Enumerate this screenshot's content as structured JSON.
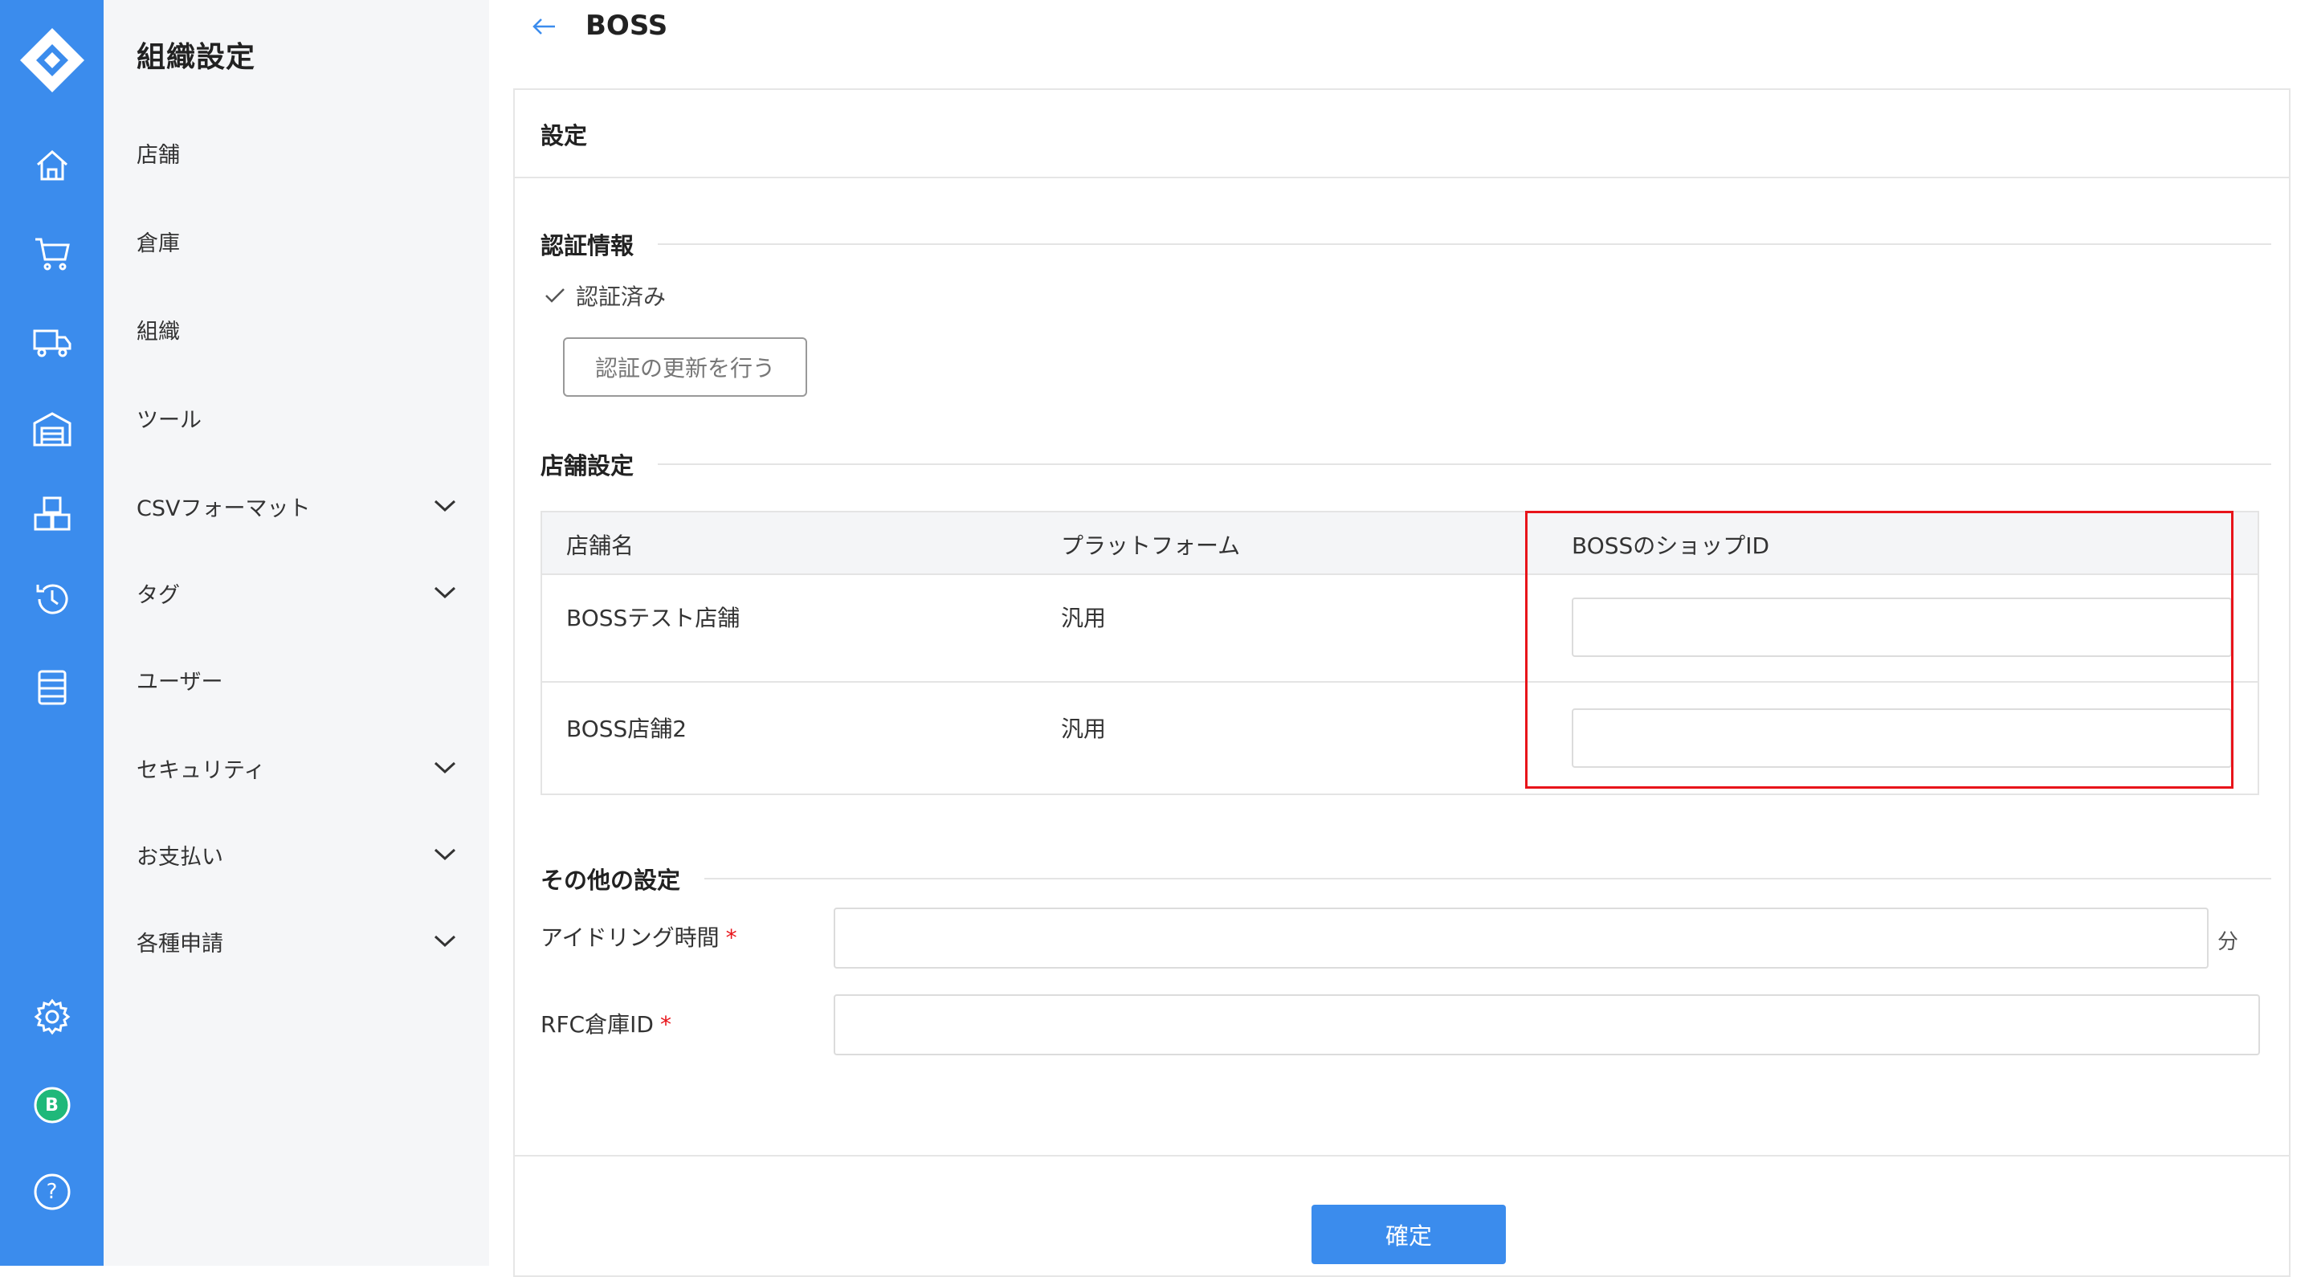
{
  "sidebar": {
    "title": "組織設定",
    "items": [
      {
        "label": "店舗",
        "has_children": false
      },
      {
        "label": "倉庫",
        "has_children": false
      },
      {
        "label": "組織",
        "has_children": false
      },
      {
        "label": "ツール",
        "has_children": false
      },
      {
        "label": "CSVフォーマット",
        "has_children": true
      },
      {
        "label": "タグ",
        "has_children": true
      },
      {
        "label": "ユーザー",
        "has_children": false
      },
      {
        "label": "セキュリティ",
        "has_children": true
      },
      {
        "label": "お支払い",
        "has_children": true
      },
      {
        "label": "各種申請",
        "has_children": true
      }
    ]
  },
  "rail": {
    "icons": [
      "logo-icon",
      "home-icon",
      "cart-icon",
      "truck-icon",
      "warehouse-icon",
      "boxes-icon",
      "history-icon",
      "list-icon",
      "gear-icon",
      "avatar",
      "help-icon"
    ],
    "avatar_letter": "B",
    "help_glyph": "?"
  },
  "header": {
    "title": "BOSS"
  },
  "card": {
    "title": "設定",
    "auth": {
      "section_label": "認証情報",
      "status": "認証済み",
      "refresh_button": "認証の更新を行う"
    },
    "shops": {
      "section_label": "店舗設定",
      "columns": [
        "店舗名",
        "プラットフォーム",
        "BOSSのショップID"
      ],
      "rows": [
        {
          "name": "BOSSテスト店舗",
          "platform": "汎用",
          "shop_id": ""
        },
        {
          "name": "BOSS店舗2",
          "platform": "汎用",
          "shop_id": ""
        }
      ]
    },
    "other": {
      "section_label": "その他の設定",
      "idle_label": "アイドリング時間",
      "idle_required": "*",
      "idle_value": "",
      "idle_unit": "分",
      "rfc_label": "RFC倉庫ID",
      "rfc_required": "*",
      "rfc_value": ""
    },
    "confirm_button": "確定"
  },
  "colors": {
    "rail_bg": "#3b8ced",
    "primary": "#3b8ced",
    "highlight": "#e8141a",
    "avatar_bg": "#1fb87a"
  }
}
